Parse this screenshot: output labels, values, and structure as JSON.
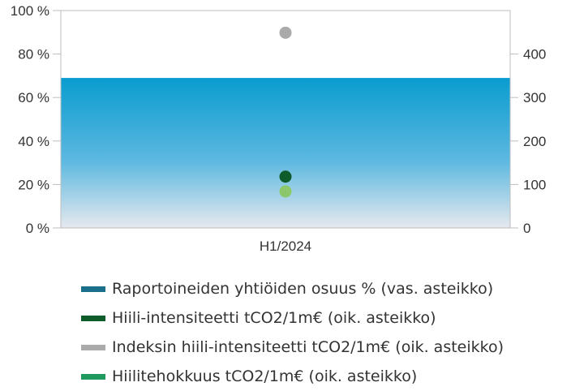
{
  "chart_data": {
    "type": "bar",
    "categories": [
      "H1/2024"
    ],
    "y_left": {
      "ticks": [
        "0 %",
        "20 %",
        "40 %",
        "60 %",
        "80 %",
        "100 %"
      ],
      "ylim": [
        0,
        100
      ]
    },
    "y_right": {
      "ticks": [
        "0",
        "100",
        "200",
        "300",
        "400"
      ],
      "ylim": [
        0,
        500
      ]
    },
    "grid": false,
    "legend_position": "bottom",
    "series": [
      {
        "name": "Raportoineiden yhtiöiden osuus % (vas. asteikko)",
        "type": "bar",
        "axis": "left",
        "values": [
          69
        ],
        "color": "#0a9ccf"
      },
      {
        "name": "Hiili-intensiteetti tCO2/1m€ (oik. asteikko)",
        "type": "scatter",
        "axis": "right",
        "values": [
          118
        ],
        "color": "#0d5c2a"
      },
      {
        "name": "Indeksin hiili-intensiteetti tCO2/1m€ (oik. asteikko)",
        "type": "scatter",
        "axis": "right",
        "values": [
          449
        ],
        "color": "#aaaaaa"
      },
      {
        "name": "Hiilitehokkuus tCO2/1m€ (oik. asteikko)",
        "type": "scatter",
        "axis": "right",
        "values": [
          84
        ],
        "color": "#8cc86b"
      }
    ],
    "legend_colors": [
      "#1a6f8a",
      "#0d5c2a",
      "#aaaaaa",
      "#1e9a5e"
    ]
  }
}
